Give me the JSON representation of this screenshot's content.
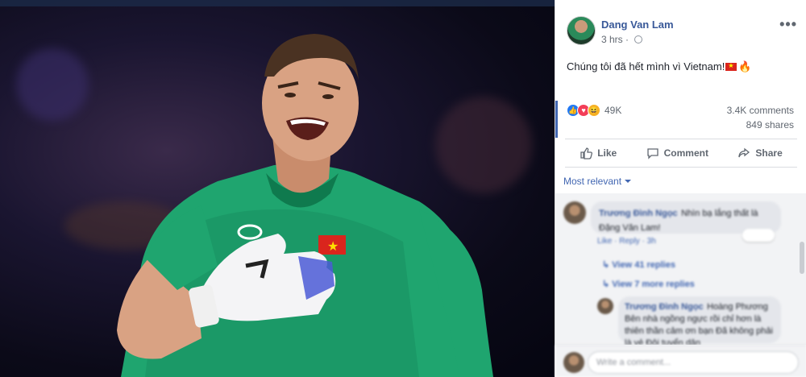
{
  "post": {
    "author": "Dang Van Lam",
    "timestamp": "3 hrs",
    "text": "Chúng tôi đã hết mình vì Vietnam!",
    "reaction_count": "49K",
    "comments_count": "3.4K comments",
    "shares_count": "849 shares"
  },
  "actions": {
    "like": "Like",
    "comment": "Comment",
    "share": "Share"
  },
  "comments_section": {
    "sort_label": "Most relevant",
    "comment1_name": "Trương Đình Ngọc",
    "comment1_text": "Nhìn bạ lắng thất là Đặng Văn Lam!",
    "comment1_meta": "Like · Reply · 3h",
    "view_replies_1": "View 41 replies",
    "view_replies_2": "View 7 more replies",
    "comment2_name": "Trương Đình Ngọc",
    "comment2_text": "Hoàng Phương Bên nhà ngồng ngực rồi chỉ hơn là thiên thần cảm ơn bạn Đã không phải là vẻ Đội tuyển dân",
    "composer_placeholder": "Write a comment..."
  },
  "colors": {
    "brand_blue": "#4267b2",
    "author_blue": "#385898",
    "jersey_green": "#19a06a"
  }
}
